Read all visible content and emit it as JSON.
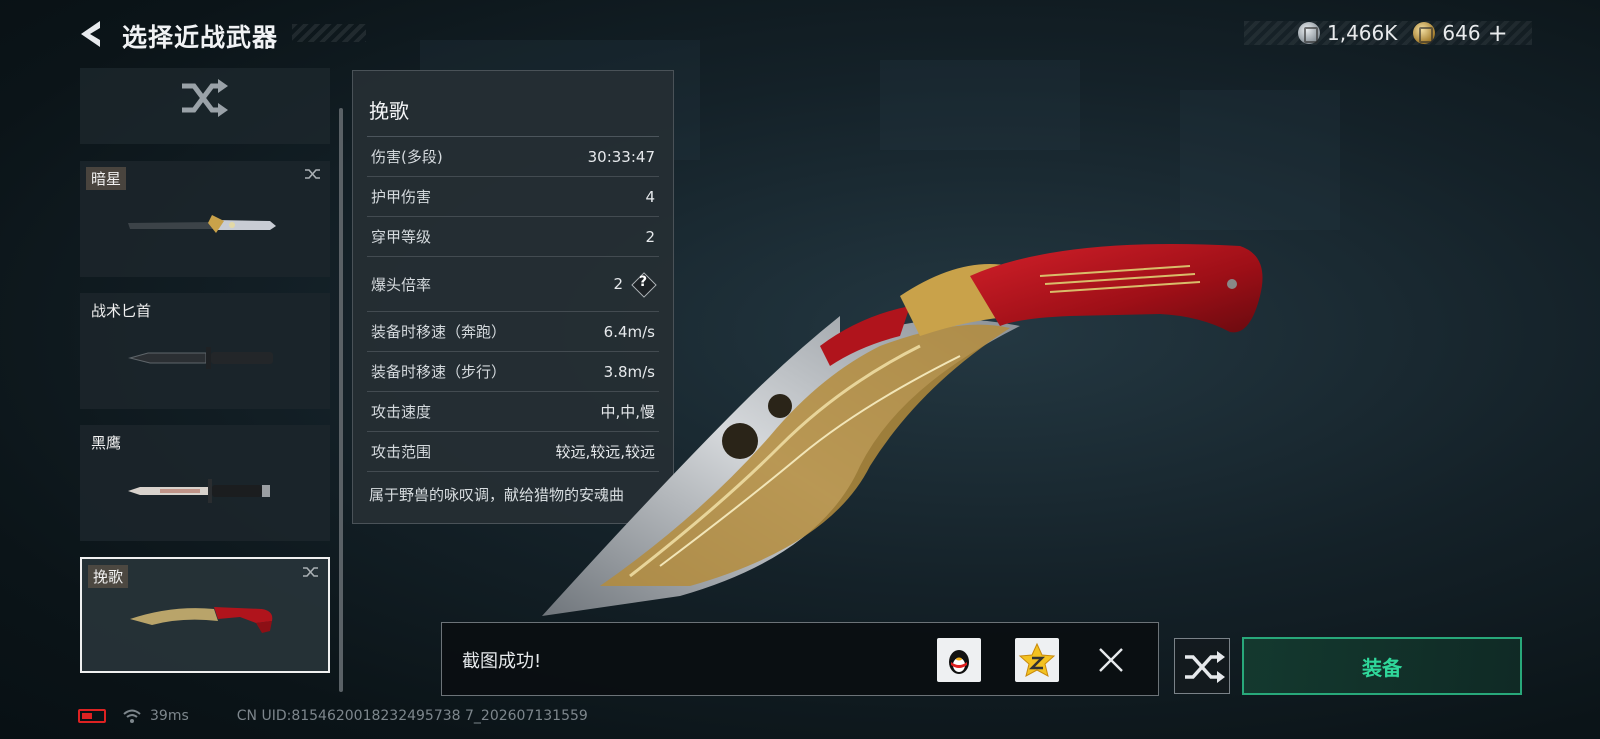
{
  "header": {
    "title": "选择近战武器",
    "back_icon": "chevron-left-icon"
  },
  "currency": {
    "silver": {
      "icon": "silver-coin-icon",
      "value": "1,466K"
    },
    "gold": {
      "icon": "gold-coin-icon",
      "value": "646"
    },
    "add_label": "+"
  },
  "weapon_list": {
    "random_icon": "shuffle-icon",
    "items": [
      {
        "name": "暗星",
        "shuffle": true,
        "selected": false
      },
      {
        "name": "战术匕首",
        "shuffle": false,
        "selected": false
      },
      {
        "name": "黑鹰",
        "shuffle": false,
        "selected": false
      },
      {
        "name": "挽歌",
        "shuffle": true,
        "selected": true
      }
    ]
  },
  "stats": {
    "name": "挽歌",
    "rows": [
      {
        "label": "伤害(多段)",
        "value": "30:33:47"
      },
      {
        "label": "护甲伤害",
        "value": "4"
      },
      {
        "label": "穿甲等级",
        "value": "2"
      },
      {
        "label": "爆头倍率",
        "value": "2",
        "help": "?"
      },
      {
        "label": "装备时移速（奔跑）",
        "value": "6.4m/s"
      },
      {
        "label": "装备时移速（步行）",
        "value": "3.8m/s"
      },
      {
        "label": "攻击速度",
        "value": "中,中,慢"
      },
      {
        "label": "攻击范围",
        "value": "较远,较远,较远"
      }
    ],
    "description": "属于野兽的咏叹调，献给猎物的安魂曲"
  },
  "toast": {
    "message": "截图成功!",
    "qq_icon": "qq-penguin-icon",
    "qzone_icon": "qzone-star-icon",
    "close_icon": "close-icon"
  },
  "actions": {
    "random_icon": "shuffle-icon",
    "equip_label": "装备"
  },
  "status": {
    "ping": "39ms",
    "uid": "CN UID:8154620018232495738 7_202607131559"
  },
  "colors": {
    "accent_green": "#2fd79a",
    "battery_red": "#dd2222",
    "knife_handle_red": "#b0141c",
    "knife_gold": "#c9a24a"
  }
}
